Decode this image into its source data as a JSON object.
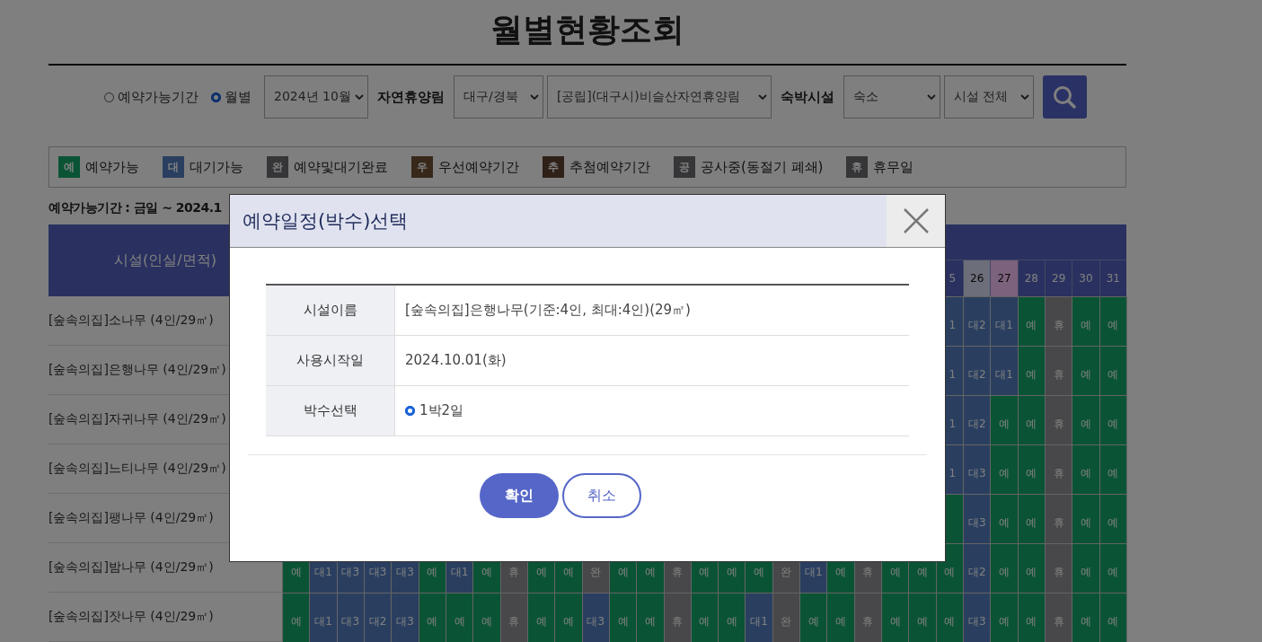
{
  "page_title": "월별현황조회",
  "filters": {
    "period_options": [
      {
        "label": "예약가능기간",
        "selected": false
      },
      {
        "label": "월별",
        "selected": true
      }
    ],
    "month": "2024년 10월",
    "forest_label": "자연휴양림",
    "region": "대구/경북",
    "forest": "[공립](대구시)비슬산자연휴양림",
    "facility_label": "숙박시설",
    "facility_type": "숙소",
    "facility": "시설 전체"
  },
  "legend": [
    {
      "badge": "예",
      "label": "예약가능",
      "kind": "open"
    },
    {
      "badge": "대",
      "label": "대기가능",
      "kind": "waiting"
    },
    {
      "badge": "완",
      "label": "예약및대기완료",
      "kind": "done"
    },
    {
      "badge": "우",
      "label": "우선예약기간",
      "kind": "priority"
    },
    {
      "badge": "추",
      "label": "추첨예약기간",
      "kind": "lottery"
    },
    {
      "badge": "공",
      "label": "공사중(동절기 폐쇄)",
      "kind": "construction"
    },
    {
      "badge": "휴",
      "label": "휴무일",
      "kind": "closed"
    }
  ],
  "availability_note": "예약가능기간 : 금일 ~ 2024.1",
  "table": {
    "facility_header": "시설(인실/면적)",
    "days": [
      {
        "label": "5",
        "kind": "weekday"
      },
      {
        "label": "26",
        "kind": "saturday"
      },
      {
        "label": "27",
        "kind": "sunday"
      },
      {
        "label": "28",
        "kind": "weekday"
      },
      {
        "label": "29",
        "kind": "weekday"
      },
      {
        "label": "30",
        "kind": "weekday"
      },
      {
        "label": "31",
        "kind": "weekday"
      }
    ],
    "rows": [
      {
        "name": "[숲속의집]소나무 (4인/29㎡)",
        "cells": [
          {
            "text": "1",
            "kind": "waiting"
          },
          {
            "text": "대2",
            "kind": "waiting"
          },
          {
            "text": "대1",
            "kind": "waiting"
          },
          {
            "text": "예",
            "kind": "open"
          },
          {
            "text": "휴",
            "kind": "closed"
          },
          {
            "text": "예",
            "kind": "open"
          },
          {
            "text": "예",
            "kind": "open"
          }
        ]
      },
      {
        "name": "[숲속의집]은행나무 (4인/29㎡)",
        "cells": [
          {
            "text": "1",
            "kind": "waiting"
          },
          {
            "text": "대2",
            "kind": "waiting"
          },
          {
            "text": "대1",
            "kind": "waiting"
          },
          {
            "text": "예",
            "kind": "open"
          },
          {
            "text": "휴",
            "kind": "closed"
          },
          {
            "text": "예",
            "kind": "open"
          },
          {
            "text": "예",
            "kind": "open"
          }
        ]
      },
      {
        "name": "[숲속의집]자귀나무 (4인/29㎡)",
        "cells": [
          {
            "text": "1",
            "kind": "waiting"
          },
          {
            "text": "대2",
            "kind": "waiting"
          },
          {
            "text": "예",
            "kind": "open"
          },
          {
            "text": "예",
            "kind": "open"
          },
          {
            "text": "휴",
            "kind": "closed"
          },
          {
            "text": "예",
            "kind": "open"
          },
          {
            "text": "예",
            "kind": "open"
          }
        ]
      },
      {
        "name": "[숲속의집]느티나무 (4인/29㎡)",
        "cells": [
          {
            "text": "1",
            "kind": "waiting"
          },
          {
            "text": "대3",
            "kind": "waiting"
          },
          {
            "text": "예",
            "kind": "open"
          },
          {
            "text": "예",
            "kind": "open"
          },
          {
            "text": "휴",
            "kind": "closed"
          },
          {
            "text": "예",
            "kind": "open"
          },
          {
            "text": "예",
            "kind": "open"
          }
        ]
      },
      {
        "name": "[숲속의집]팽나무 (4인/29㎡)",
        "cells": [
          {
            "kind": "open"
          },
          {
            "text": "대3",
            "kind": "waiting"
          },
          {
            "text": "예",
            "kind": "open"
          },
          {
            "text": "예",
            "kind": "open"
          },
          {
            "text": "휴",
            "kind": "closed"
          },
          {
            "text": "예",
            "kind": "open"
          },
          {
            "text": "예",
            "kind": "open"
          }
        ]
      },
      {
        "name": "[숲속의집]밤나무 (4인/29㎡)",
        "cells": [
          {
            "text": "예",
            "kind": "open"
          },
          {
            "text": "대1",
            "kind": "waiting"
          },
          {
            "text": "대3",
            "kind": "waiting"
          },
          {
            "text": "대3",
            "kind": "waiting"
          },
          {
            "text": "대3",
            "kind": "waiting"
          },
          {
            "text": "예",
            "kind": "open"
          },
          {
            "text": "대1",
            "kind": "waiting"
          },
          {
            "text": "예",
            "kind": "open"
          },
          {
            "text": "휴",
            "kind": "closed"
          },
          {
            "text": "예",
            "kind": "open"
          },
          {
            "text": "예",
            "kind": "open"
          },
          {
            "text": "완",
            "kind": "done"
          },
          {
            "text": "예",
            "kind": "open"
          },
          {
            "text": "예",
            "kind": "open"
          },
          {
            "text": "휴",
            "kind": "closed"
          },
          {
            "text": "예",
            "kind": "open"
          },
          {
            "text": "예",
            "kind": "open"
          },
          {
            "text": "예",
            "kind": "open"
          },
          {
            "text": "완",
            "kind": "done"
          },
          {
            "text": "대1",
            "kind": "waiting"
          },
          {
            "text": "예",
            "kind": "open"
          },
          {
            "text": "휴",
            "kind": "closed"
          },
          {
            "text": "예",
            "kind": "open"
          },
          {
            "text": "예",
            "kind": "open"
          },
          {
            "text": "예",
            "kind": "open"
          },
          {
            "text": "대2",
            "kind": "waiting"
          },
          {
            "text": "예",
            "kind": "open"
          },
          {
            "text": "예",
            "kind": "open"
          },
          {
            "text": "휴",
            "kind": "closed"
          },
          {
            "text": "예",
            "kind": "open"
          },
          {
            "text": "예",
            "kind": "open"
          }
        ]
      },
      {
        "name": "[숲속의집]잣나무 (4인/29㎡)",
        "cells": [
          {
            "text": "예",
            "kind": "open"
          },
          {
            "text": "대1",
            "kind": "waiting"
          },
          {
            "text": "대3",
            "kind": "waiting"
          },
          {
            "text": "대2",
            "kind": "waiting"
          },
          {
            "text": "대3",
            "kind": "waiting"
          },
          {
            "text": "예",
            "kind": "open"
          },
          {
            "text": "예",
            "kind": "open"
          },
          {
            "text": "예",
            "kind": "open"
          },
          {
            "text": "휴",
            "kind": "closed"
          },
          {
            "text": "예",
            "kind": "open"
          },
          {
            "text": "예",
            "kind": "open"
          },
          {
            "text": "대3",
            "kind": "waiting"
          },
          {
            "text": "예",
            "kind": "open"
          },
          {
            "text": "예",
            "kind": "open"
          },
          {
            "text": "휴",
            "kind": "closed"
          },
          {
            "text": "예",
            "kind": "open"
          },
          {
            "text": "예",
            "kind": "open"
          },
          {
            "text": "대1",
            "kind": "waiting"
          },
          {
            "text": "완",
            "kind": "done"
          },
          {
            "text": "예",
            "kind": "open"
          },
          {
            "text": "예",
            "kind": "open"
          },
          {
            "text": "휴",
            "kind": "closed"
          },
          {
            "text": "예",
            "kind": "open"
          },
          {
            "text": "예",
            "kind": "open"
          },
          {
            "text": "예",
            "kind": "open"
          },
          {
            "text": "대3",
            "kind": "waiting"
          },
          {
            "text": "예",
            "kind": "open"
          },
          {
            "text": "예",
            "kind": "open"
          },
          {
            "text": "휴",
            "kind": "closed"
          },
          {
            "text": "예",
            "kind": "open"
          },
          {
            "text": "예",
            "kind": "open"
          }
        ]
      }
    ]
  },
  "modal": {
    "title": "예약일정(박수)선택",
    "fields": [
      {
        "label": "시설이름",
        "value": "[숲속의집]은행나무(기준:4인, 최대:4인)(29㎡)"
      },
      {
        "label": "사용시작일",
        "value": "2024.10.01(화)"
      }
    ],
    "nights": {
      "label": "박수선택",
      "options": [
        {
          "label": "1박2일",
          "selected": true
        }
      ]
    },
    "confirm": "확인",
    "cancel": "취소"
  }
}
